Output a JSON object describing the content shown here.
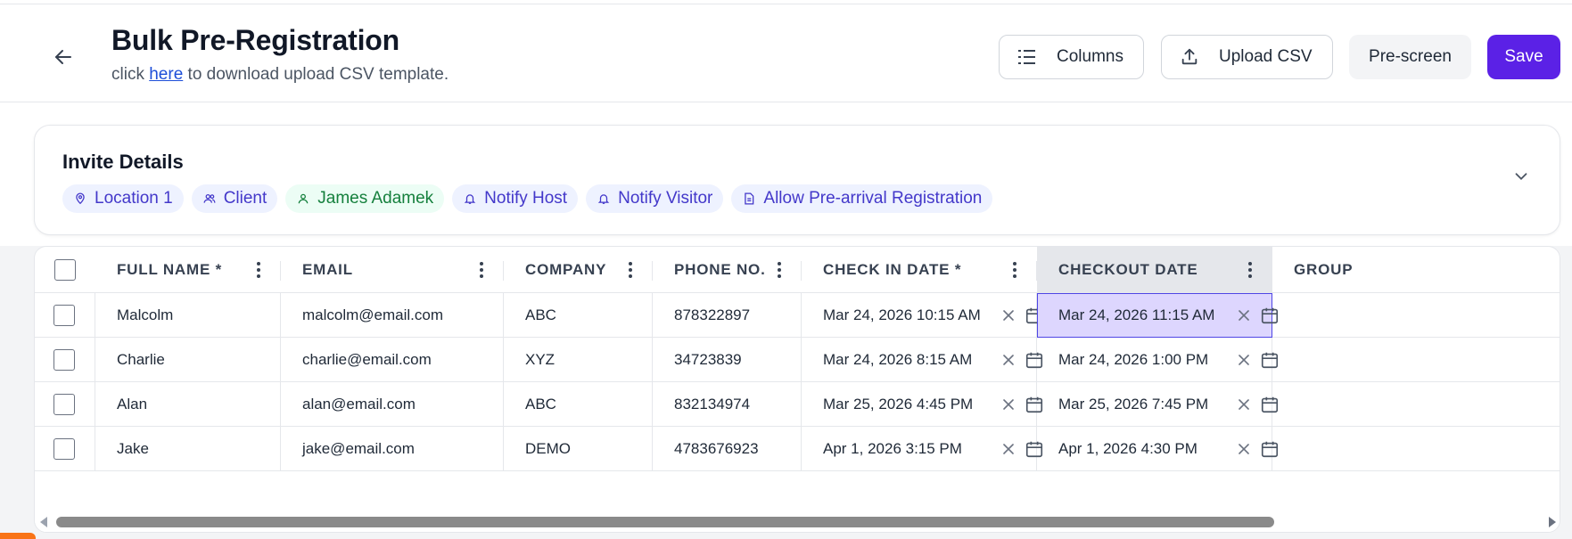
{
  "header": {
    "title": "Bulk Pre-Registration",
    "subtitle_prefix": "click",
    "subtitle_link": "here",
    "subtitle_suffix": "to download upload CSV template.",
    "buttons": {
      "columns": "Columns",
      "upload_csv": "Upload CSV",
      "prescreen": "Pre-screen",
      "save": "Save"
    },
    "icons": {
      "back": "arrow-left-icon",
      "columns": "list-icon",
      "upload": "upload-icon"
    }
  },
  "invite": {
    "title": "Invite Details",
    "chips": [
      {
        "label": "Location 1",
        "icon": "map-pin-icon",
        "color": "#4338ca"
      },
      {
        "label": "Client",
        "icon": "users-icon",
        "color": "#4338ca"
      },
      {
        "label": "James Adamek",
        "icon": "user-icon",
        "color": "#15803d"
      },
      {
        "label": "Notify Host",
        "icon": "bell-icon",
        "color": "#4338ca"
      },
      {
        "label": "Notify Visitor",
        "icon": "bell-icon",
        "color": "#4338ca"
      },
      {
        "label": "Allow Pre-arrival Registration",
        "icon": "document-icon",
        "color": "#4338ca"
      }
    ],
    "collapse_icon": "chevron-down-icon"
  },
  "table": {
    "columns": [
      "FULL NAME *",
      "EMAIL",
      "COMPANY",
      "PHONE NO.",
      "CHECK IN DATE *",
      "CHECKOUT DATE",
      "GROUP"
    ],
    "selected_column": "CHECKOUT DATE",
    "rows": [
      {
        "full_name": "Malcolm",
        "email": "malcolm@email.com",
        "company": "ABC",
        "phone": "878322897",
        "check_in": "Mar 24, 2026 10:15 AM",
        "checkout": "Mar 24, 2026 11:15 AM",
        "group": ""
      },
      {
        "full_name": "Charlie",
        "email": "charlie@email.com",
        "company": "XYZ",
        "phone": "34723839",
        "check_in": "Mar 24, 2026 8:15 AM",
        "checkout": "Mar 24, 2026 1:00 PM",
        "group": ""
      },
      {
        "full_name": "Alan",
        "email": "alan@email.com",
        "company": "ABC",
        "phone": "832134974",
        "check_in": "Mar 25, 2026 4:45 PM",
        "checkout": "Mar 25, 2026 7:45 PM",
        "group": ""
      },
      {
        "full_name": "Jake",
        "email": "jake@email.com",
        "company": "DEMO",
        "phone": "4783676923",
        "check_in": "Apr 1, 2026 3:15 PM",
        "checkout": "Apr 1, 2026 4:30 PM",
        "group": ""
      }
    ]
  },
  "colors": {
    "primary": "#5b21e6",
    "active_cell": "#ddd6fe",
    "chip_blue_bg": "#eef2ff",
    "chip_green_bg": "#ecfdf5"
  }
}
